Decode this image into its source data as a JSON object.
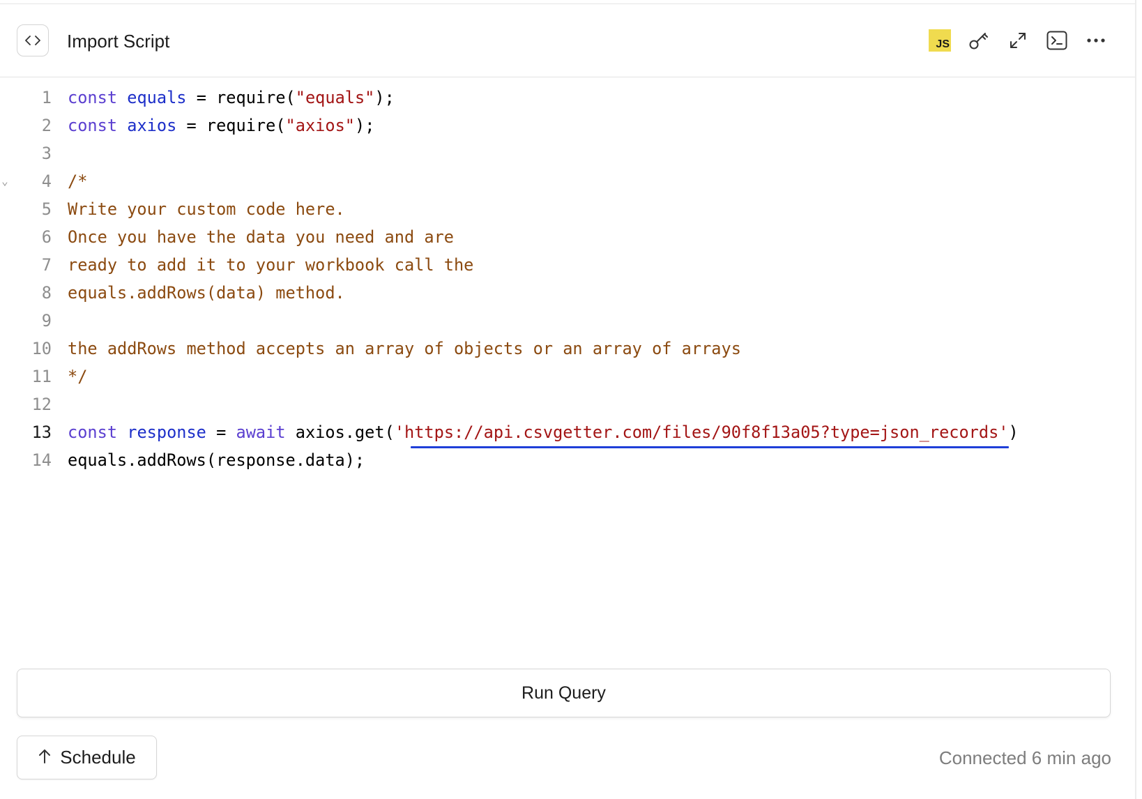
{
  "header": {
    "title": "Import Script",
    "language_badge": "JS"
  },
  "toolbar_icons": [
    "code-icon",
    "key-icon",
    "expand-icon",
    "terminal-icon",
    "more-icon"
  ],
  "editor": {
    "active_line": 13,
    "lines": [
      {
        "num": "1",
        "tokens": [
          [
            "kw",
            "const"
          ],
          [
            "p",
            " "
          ],
          [
            "var",
            "equals"
          ],
          [
            "p",
            " = require("
          ],
          [
            "str",
            "\"equals\""
          ],
          [
            "p",
            ");"
          ]
        ]
      },
      {
        "num": "2",
        "tokens": [
          [
            "kw",
            "const"
          ],
          [
            "p",
            " "
          ],
          [
            "var",
            "axios"
          ],
          [
            "p",
            " = require("
          ],
          [
            "str",
            "\"axios\""
          ],
          [
            "p",
            ");"
          ]
        ]
      },
      {
        "num": "3",
        "tokens": []
      },
      {
        "num": "4",
        "fold": true,
        "tokens": [
          [
            "cmt",
            "/*"
          ]
        ]
      },
      {
        "num": "5",
        "tokens": [
          [
            "cmt",
            "Write your custom code here."
          ]
        ]
      },
      {
        "num": "6",
        "tokens": [
          [
            "cmt",
            "Once you have the data you need and are"
          ]
        ]
      },
      {
        "num": "7",
        "tokens": [
          [
            "cmt",
            "ready to add it to your workbook call the"
          ]
        ]
      },
      {
        "num": "8",
        "tokens": [
          [
            "cmt",
            "equals.addRows(data) method."
          ]
        ]
      },
      {
        "num": "9",
        "tokens": []
      },
      {
        "num": "10",
        "tokens": [
          [
            "cmt",
            "the addRows method accepts an array of objects or an array of arrays"
          ]
        ]
      },
      {
        "num": "11",
        "tokens": [
          [
            "cmt",
            "*/"
          ]
        ]
      },
      {
        "num": "12",
        "tokens": []
      },
      {
        "num": "13",
        "tokens": [
          [
            "kw",
            "const"
          ],
          [
            "p",
            " "
          ],
          [
            "var",
            "response"
          ],
          [
            "p",
            " = "
          ],
          [
            "kw",
            "await"
          ],
          [
            "p",
            " axios.get("
          ],
          [
            "str",
            "'https://api.csvgetter.com/files/90f8f13a05?type=json_records'"
          ],
          [
            "p",
            ")"
          ]
        ]
      },
      {
        "num": "14",
        "tokens": [
          [
            "p",
            "equals.addRows(response.data);"
          ]
        ]
      }
    ]
  },
  "actions": {
    "run_label": "Run Query",
    "schedule_label": "Schedule"
  },
  "status": {
    "text": "Connected 6 min ago"
  },
  "colors": {
    "keyword": "#5b3fd0",
    "variable": "#1d2fc9",
    "string": "#a31515",
    "comment": "#8b4a10",
    "js_badge": "#f0db4f"
  }
}
